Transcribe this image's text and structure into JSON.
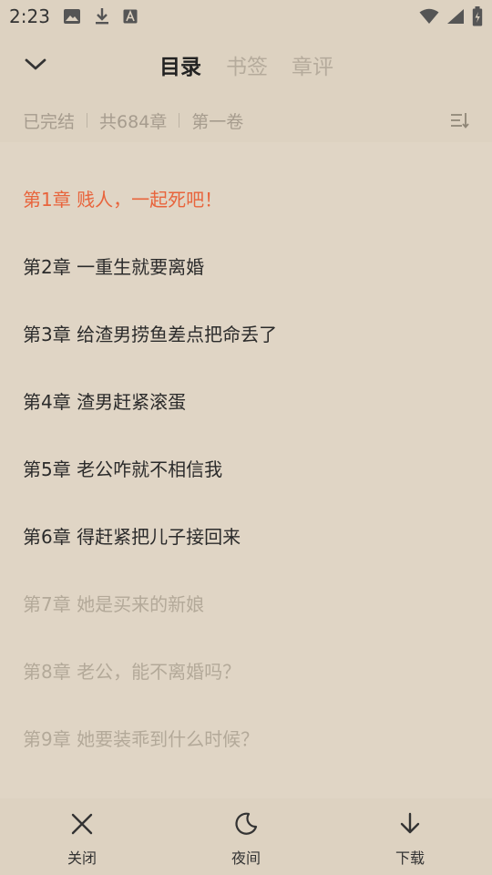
{
  "status_bar": {
    "time": "2:23",
    "left_icons": [
      "image-icon",
      "download-icon",
      "font-icon"
    ],
    "right_icons": [
      "wifi-icon",
      "signal-icon",
      "battery-charging-icon"
    ]
  },
  "header": {
    "back_icon": "chevron-down-icon",
    "tabs": [
      {
        "label": "目录",
        "active": true
      },
      {
        "label": "书签",
        "active": false
      },
      {
        "label": "章评",
        "active": false
      }
    ]
  },
  "info": {
    "status": "已完结",
    "count": "共684章",
    "volume": "第一卷",
    "sort_icon": "sort-icon"
  },
  "chapters": [
    {
      "title": "第1章 贱人，一起死吧！",
      "state": "current"
    },
    {
      "title": "第2章 一重生就要离婚",
      "state": "free"
    },
    {
      "title": "第3章 给渣男捞鱼差点把命丢了",
      "state": "free"
    },
    {
      "title": "第4章 渣男赶紧滚蛋",
      "state": "free"
    },
    {
      "title": "第5章 老公咋就不相信我",
      "state": "free"
    },
    {
      "title": "第6章 得赶紧把儿子接回来",
      "state": "free"
    },
    {
      "title": "第7章 她是买来的新娘",
      "state": "locked"
    },
    {
      "title": "第8章 老公，能不离婚吗？",
      "state": "locked"
    },
    {
      "title": "第9章 她要装乖到什么时候？",
      "state": "locked"
    }
  ],
  "bottom": {
    "close": "关闭",
    "night": "夜间",
    "download": "下载"
  },
  "colors": {
    "background": "#e0d5c5",
    "current_chapter": "#e8643c",
    "locked_chapter": "#b3a999",
    "active_tab": "#222222",
    "inactive_tab": "#b5ab9c"
  }
}
